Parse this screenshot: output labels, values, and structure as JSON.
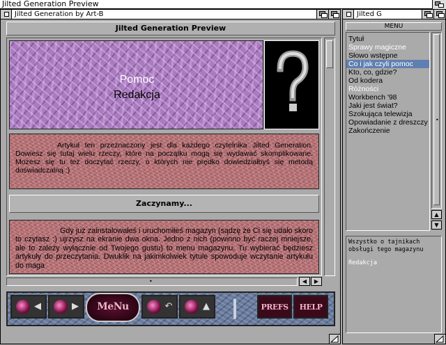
{
  "screen": {
    "title": "Jilted Generation Preview"
  },
  "main_window": {
    "title": "Jilted Generation by Art-B",
    "header": "Jilted Generation Preview",
    "banner": {
      "line1": "Pomoc",
      "line2": "Redakcja",
      "icon": "question-mark-icon"
    },
    "intro_text": "Artykuł ten przeznaczony jest dla każdego czytelnika Jilted Generation. Dowiesz się tutaj wielu rzeczy, które na początku mogą się wydawać skomplikowane. Możesz się tu też doczytać rzeczy, o których nie prędko dowiedziałbyś się metodą doświadczalną :)",
    "section_heading": "Zaczynamy...",
    "body_text": "Gdy już zainstalowałeś i uruchomiłeś magazyn (sądzę że Ci się udało skoro to czytasz :) ujrzysz na ekranie dwa okna. Jedno z nich (powinno być raczej mniejsze, ale to zależy wyłącznie od Twojego gustu) to menu magazynu. Tu wybierać będziesz artykuły do przeczytania. Dwuklik na jakimkolwiek tytule spowoduje wczytanie artykułu do maga",
    "toolbar": {
      "buttons": [
        {
          "name": "prev-article-button",
          "icon": "arrow-left-icon"
        },
        {
          "name": "next-article-button",
          "icon": "arrow-right-icon"
        },
        {
          "name": "menu-button",
          "label": "MeNu"
        },
        {
          "name": "page-back-button",
          "icon": "arrow-back-icon"
        },
        {
          "name": "page-up-button",
          "icon": "arrow-up-icon"
        },
        {
          "name": "prefs-button",
          "label": "PREFS"
        },
        {
          "name": "help-button",
          "label": "HELP"
        }
      ]
    }
  },
  "menu_window": {
    "title": "Jilted G",
    "header": "MENU",
    "items": [
      {
        "label": "Tytuł",
        "state": "normal"
      },
      {
        "label": "Sprawy magiczne",
        "state": "dim"
      },
      {
        "label": "Słowo wstępne",
        "state": "normal"
      },
      {
        "label": "Co i jak czyli pomoc",
        "state": "selected"
      },
      {
        "label": "Kto, co, gdzie?",
        "state": "normal"
      },
      {
        "label": "Od kodera",
        "state": "normal"
      },
      {
        "label": "Różności",
        "state": "dim"
      },
      {
        "label": "Workbench '98",
        "state": "normal"
      },
      {
        "label": "Jaki jest świat?",
        "state": "normal"
      },
      {
        "label": "Szokująca telewizja",
        "state": "normal"
      },
      {
        "label": "Opowiadanie z dreszczy",
        "state": "normal"
      },
      {
        "label": "Zakończenie",
        "state": "normal"
      }
    ],
    "description": "Wszystko o tajnikach obsługi tego magazynu",
    "author": "Redakcja"
  },
  "colors": {
    "selection": "#5f7fb0",
    "granite": "#b46e72",
    "marble": "#a97cc0",
    "panel": "#aaaaaa"
  }
}
